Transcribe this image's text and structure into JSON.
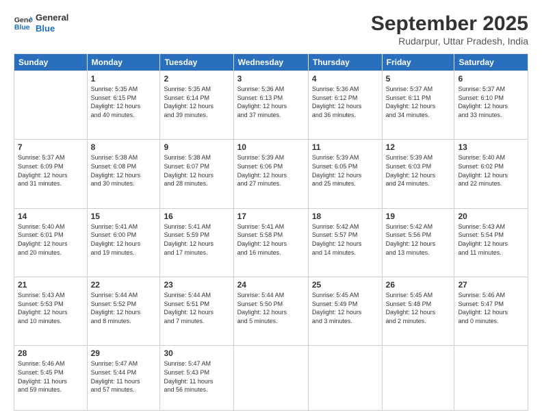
{
  "logo": {
    "line1": "General",
    "line2": "Blue"
  },
  "header": {
    "month": "September 2025",
    "location": "Rudarpur, Uttar Pradesh, India"
  },
  "days_of_week": [
    "Sunday",
    "Monday",
    "Tuesday",
    "Wednesday",
    "Thursday",
    "Friday",
    "Saturday"
  ],
  "weeks": [
    [
      {
        "day": "",
        "info": ""
      },
      {
        "day": "1",
        "info": "Sunrise: 5:35 AM\nSunset: 6:15 PM\nDaylight: 12 hours\nand 40 minutes."
      },
      {
        "day": "2",
        "info": "Sunrise: 5:35 AM\nSunset: 6:14 PM\nDaylight: 12 hours\nand 39 minutes."
      },
      {
        "day": "3",
        "info": "Sunrise: 5:36 AM\nSunset: 6:13 PM\nDaylight: 12 hours\nand 37 minutes."
      },
      {
        "day": "4",
        "info": "Sunrise: 5:36 AM\nSunset: 6:12 PM\nDaylight: 12 hours\nand 36 minutes."
      },
      {
        "day": "5",
        "info": "Sunrise: 5:37 AM\nSunset: 6:11 PM\nDaylight: 12 hours\nand 34 minutes."
      },
      {
        "day": "6",
        "info": "Sunrise: 5:37 AM\nSunset: 6:10 PM\nDaylight: 12 hours\nand 33 minutes."
      }
    ],
    [
      {
        "day": "7",
        "info": "Sunrise: 5:37 AM\nSunset: 6:09 PM\nDaylight: 12 hours\nand 31 minutes."
      },
      {
        "day": "8",
        "info": "Sunrise: 5:38 AM\nSunset: 6:08 PM\nDaylight: 12 hours\nand 30 minutes."
      },
      {
        "day": "9",
        "info": "Sunrise: 5:38 AM\nSunset: 6:07 PM\nDaylight: 12 hours\nand 28 minutes."
      },
      {
        "day": "10",
        "info": "Sunrise: 5:39 AM\nSunset: 6:06 PM\nDaylight: 12 hours\nand 27 minutes."
      },
      {
        "day": "11",
        "info": "Sunrise: 5:39 AM\nSunset: 6:05 PM\nDaylight: 12 hours\nand 25 minutes."
      },
      {
        "day": "12",
        "info": "Sunrise: 5:39 AM\nSunset: 6:03 PM\nDaylight: 12 hours\nand 24 minutes."
      },
      {
        "day": "13",
        "info": "Sunrise: 5:40 AM\nSunset: 6:02 PM\nDaylight: 12 hours\nand 22 minutes."
      }
    ],
    [
      {
        "day": "14",
        "info": "Sunrise: 5:40 AM\nSunset: 6:01 PM\nDaylight: 12 hours\nand 20 minutes."
      },
      {
        "day": "15",
        "info": "Sunrise: 5:41 AM\nSunset: 6:00 PM\nDaylight: 12 hours\nand 19 minutes."
      },
      {
        "day": "16",
        "info": "Sunrise: 5:41 AM\nSunset: 5:59 PM\nDaylight: 12 hours\nand 17 minutes."
      },
      {
        "day": "17",
        "info": "Sunrise: 5:41 AM\nSunset: 5:58 PM\nDaylight: 12 hours\nand 16 minutes."
      },
      {
        "day": "18",
        "info": "Sunrise: 5:42 AM\nSunset: 5:57 PM\nDaylight: 12 hours\nand 14 minutes."
      },
      {
        "day": "19",
        "info": "Sunrise: 5:42 AM\nSunset: 5:56 PM\nDaylight: 12 hours\nand 13 minutes."
      },
      {
        "day": "20",
        "info": "Sunrise: 5:43 AM\nSunset: 5:54 PM\nDaylight: 12 hours\nand 11 minutes."
      }
    ],
    [
      {
        "day": "21",
        "info": "Sunrise: 5:43 AM\nSunset: 5:53 PM\nDaylight: 12 hours\nand 10 minutes."
      },
      {
        "day": "22",
        "info": "Sunrise: 5:44 AM\nSunset: 5:52 PM\nDaylight: 12 hours\nand 8 minutes."
      },
      {
        "day": "23",
        "info": "Sunrise: 5:44 AM\nSunset: 5:51 PM\nDaylight: 12 hours\nand 7 minutes."
      },
      {
        "day": "24",
        "info": "Sunrise: 5:44 AM\nSunset: 5:50 PM\nDaylight: 12 hours\nand 5 minutes."
      },
      {
        "day": "25",
        "info": "Sunrise: 5:45 AM\nSunset: 5:49 PM\nDaylight: 12 hours\nand 3 minutes."
      },
      {
        "day": "26",
        "info": "Sunrise: 5:45 AM\nSunset: 5:48 PM\nDaylight: 12 hours\nand 2 minutes."
      },
      {
        "day": "27",
        "info": "Sunrise: 5:46 AM\nSunset: 5:47 PM\nDaylight: 12 hours\nand 0 minutes."
      }
    ],
    [
      {
        "day": "28",
        "info": "Sunrise: 5:46 AM\nSunset: 5:45 PM\nDaylight: 11 hours\nand 59 minutes."
      },
      {
        "day": "29",
        "info": "Sunrise: 5:47 AM\nSunset: 5:44 PM\nDaylight: 11 hours\nand 57 minutes."
      },
      {
        "day": "30",
        "info": "Sunrise: 5:47 AM\nSunset: 5:43 PM\nDaylight: 11 hours\nand 56 minutes."
      },
      {
        "day": "",
        "info": ""
      },
      {
        "day": "",
        "info": ""
      },
      {
        "day": "",
        "info": ""
      },
      {
        "day": "",
        "info": ""
      }
    ]
  ]
}
